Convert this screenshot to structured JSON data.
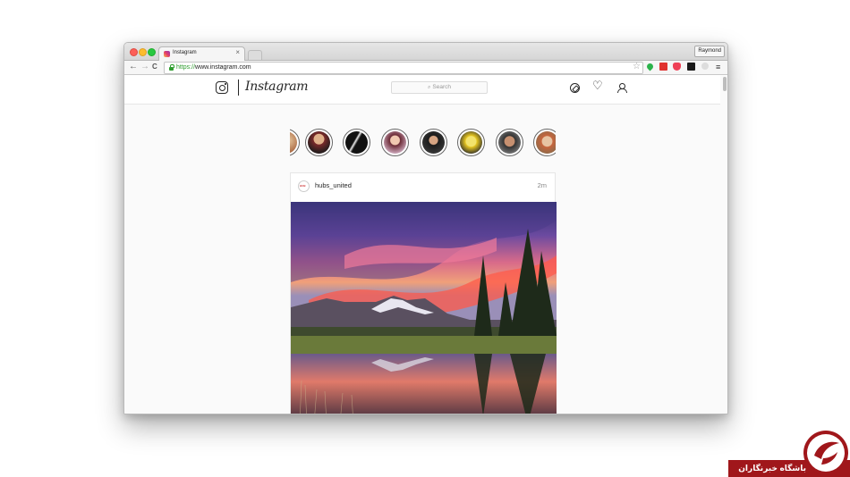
{
  "browser": {
    "tab_title": "Instagram",
    "tab_close": "×",
    "profile_name": "Raymond",
    "url_protocol": "https://",
    "url_rest": "www.instagram.com",
    "back_icon": "←",
    "forward_icon": "→",
    "reload_icon": "C",
    "bookmark_icon": "☆",
    "menu_icon": "≡"
  },
  "instagram": {
    "wordmark": "Instagram",
    "search_placeholder": "Search",
    "stories_count": 8,
    "post": {
      "username": "hubs_united",
      "time": "2m"
    }
  },
  "watermark": {
    "text": "باشگاه خبرنگاران"
  }
}
